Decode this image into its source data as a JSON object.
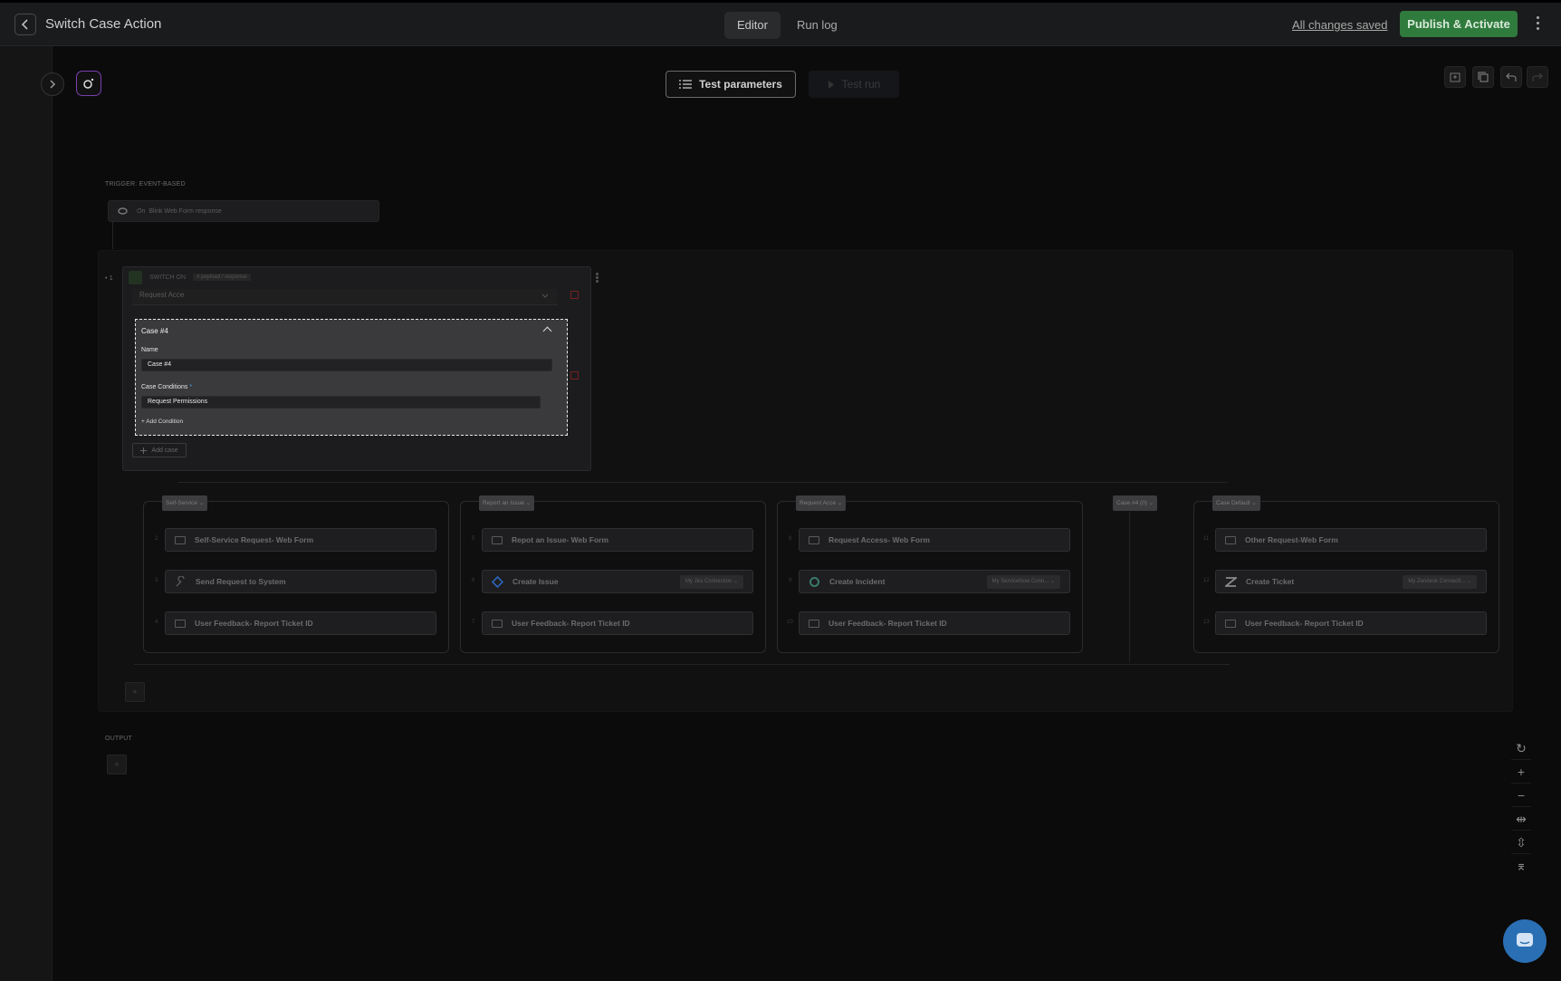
{
  "header": {
    "title": "Switch Case Action",
    "tabs": [
      {
        "label": "Editor",
        "active": true
      },
      {
        "label": "Run log",
        "active": false
      }
    ],
    "saved_status": "All changes saved",
    "publish_label": "Publish & Activate"
  },
  "toolbar": {
    "test_parameters_label": "Test parameters",
    "test_run_label": "Test run"
  },
  "trigger": {
    "section_label": "TRIGGER: EVENT-BASED",
    "prefix": "On",
    "text": "Blink Web Form response"
  },
  "switch": {
    "step_number": "• 1",
    "label": "SWITCH ON",
    "param": "# payload / response",
    "collapsed_case": "Request Acce",
    "add_case_label": "Add case"
  },
  "case_panel": {
    "title": "Case #4",
    "name_label": "Name",
    "name_value": "Case #4",
    "conditions_label": "Case Conditions",
    "required_mark": "*",
    "conditions_value": "Request Permissions",
    "add_condition_label": "+ Add Condition"
  },
  "branches": [
    {
      "tag": "Self-Service",
      "steps": [
        {
          "num": "2",
          "label": "Self-Service Request- Web Form",
          "icon": "form-icon"
        },
        {
          "num": "3",
          "label": "Send Request to System",
          "icon": "wrench-icon"
        },
        {
          "num": "4",
          "label": "User Feedback- Report Ticket ID",
          "icon": "form-icon"
        }
      ]
    },
    {
      "tag": "Report an Issue",
      "steps": [
        {
          "num": "5",
          "label": "Repot an Issue- Web Form",
          "icon": "form-icon"
        },
        {
          "num": "6",
          "label": "Create Issue",
          "icon": "jira-icon",
          "connection": "My Jira Connection"
        },
        {
          "num": "7",
          "label": "User Feedback- Report Ticket ID",
          "icon": "form-icon"
        }
      ]
    },
    {
      "tag": "Request Acce",
      "steps": [
        {
          "num": "8",
          "label": "Request Access- Web Form",
          "icon": "form-icon"
        },
        {
          "num": "9",
          "label": "Create Incident",
          "icon": "servicenow-icon",
          "connection": "My ServiceNow Conn..."
        },
        {
          "num": "10",
          "label": "User Feedback- Report Ticket ID",
          "icon": "form-icon"
        }
      ]
    },
    {
      "tag": "Case #4 (0)",
      "steps": []
    },
    {
      "tag": "Case Default",
      "steps": [
        {
          "num": "11",
          "label": "Other Request-Web Form",
          "icon": "form-icon"
        },
        {
          "num": "12",
          "label": "Create Ticket",
          "icon": "zendesk-icon",
          "connection": "My Zendesk Connecti..."
        },
        {
          "num": "13",
          "label": "User Feedback- Report Ticket ID",
          "icon": "form-icon"
        }
      ]
    }
  ],
  "output": {
    "section_label": "OUTPUT"
  },
  "zoom_controls": [
    "reset-icon",
    "zoom-in-icon",
    "zoom-out-icon",
    "fit-width-icon",
    "fit-height-icon",
    "collapse-icon"
  ],
  "colors": {
    "accent_green": "#2f7a3d",
    "chat_blue": "#2a6fb4",
    "case_border": "#e8e8e8"
  }
}
